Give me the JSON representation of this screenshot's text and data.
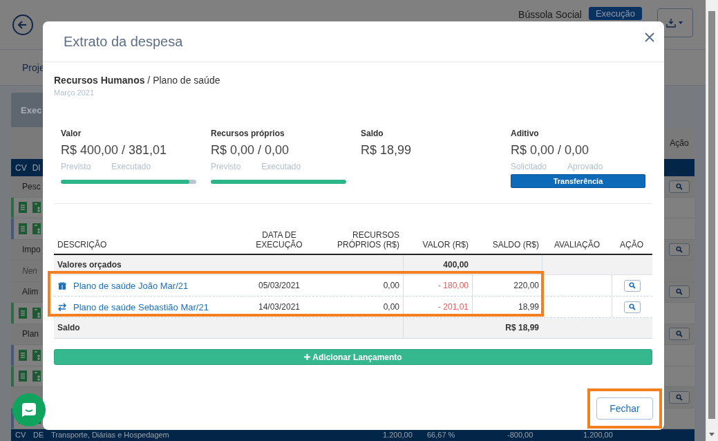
{
  "background": {
    "header": {
      "sync_label": "Bússola Social",
      "status_badge": "Execução"
    },
    "tabs": [
      {
        "label": "Proje",
        "selected": true
      }
    ],
    "section_tab": "Exec",
    "table": {
      "header_columns": [
        "CV",
        "DI"
      ],
      "action_header": "Ação",
      "rows": [
        {
          "kind": "group",
          "label": "Pesc",
          "action": true
        },
        {
          "kind": "item",
          "color": "#2f6a44",
          "action": false
        },
        {
          "kind": "item",
          "color": "#46587a",
          "action": false
        },
        {
          "kind": "group",
          "label": "Impo",
          "action": true
        },
        {
          "kind": "note",
          "label": "Nen",
          "action": false
        },
        {
          "kind": "group",
          "label": "Alim",
          "action": true
        },
        {
          "kind": "item",
          "color": "#2f6a44",
          "action": false
        },
        {
          "kind": "group",
          "label": "Plan",
          "action": true
        },
        {
          "kind": "item",
          "color": "#46587a",
          "action": false
        },
        {
          "kind": "item",
          "color": "#2f6a44",
          "action": false
        },
        {
          "kind": "group",
          "action": true
        },
        {
          "kind": "item",
          "color": "#46587a",
          "action": false
        }
      ],
      "total_row": [
        "CV",
        "DE",
        "Transporte, Diárias e Hospedagem",
        "1.200,00",
        "66,67 %",
        "-800,00",
        "1.200,00"
      ]
    }
  },
  "modal": {
    "title": "Extrato da despesa",
    "breadcrumb": "**Recursos Humanos** / Plano de saúde",
    "period": "Março 2021",
    "summary": [
      {
        "kind": "progress",
        "label": "Valor",
        "amount": "R$ 400,00 / 381,01",
        "captions": [
          "Previsto",
          "Executado"
        ],
        "level": 0.95
      },
      {
        "kind": "progress",
        "label": "Recursos próprios",
        "amount": "R$ 0,00 / 0,00",
        "captions": [
          "Previsto",
          "Executado"
        ],
        "level": 1
      },
      {
        "kind": "plain",
        "label": "Saldo",
        "amount": "R$ 18,99"
      },
      {
        "kind": "button",
        "label": "Aditivo",
        "amount": "R$ 0,00 / 0,00",
        "captions": [
          "Solicitado",
          "Aprovado"
        ],
        "button": "Transferência"
      }
    ],
    "table": {
      "columns": [
        "DESCRIÇÃO",
        "DATA DE EXECUÇÃO",
        "RECURSOS PRÓPRIOS (R$)",
        "VALOR (R$)",
        "SALDO (R$)",
        "AVALIAÇÃO",
        "AÇÃO"
      ],
      "budget_row": {
        "label": "Valores orçados",
        "value": "400,00"
      },
      "entries_highlighted": true,
      "entries": [
        {
          "kind": "gift",
          "description": "Plano de saúde João Mar/21",
          "date": "05/03/2021",
          "own": "0,00",
          "value": "- 180,00",
          "balance": "220,00"
        },
        {
          "kind": "transfer",
          "description": "Plano de saúde Sebastião Mar/21",
          "date": "14/03/2021",
          "own": "0,00",
          "value": "- 201,01",
          "balance": "18,99"
        }
      ],
      "balance_row": {
        "label": "Saldo",
        "value": "R$ 18,99"
      }
    },
    "add_button": "Adicionar Lançamento",
    "close_button": {
      "label": "Fechar",
      "highlighted": true
    }
  }
}
